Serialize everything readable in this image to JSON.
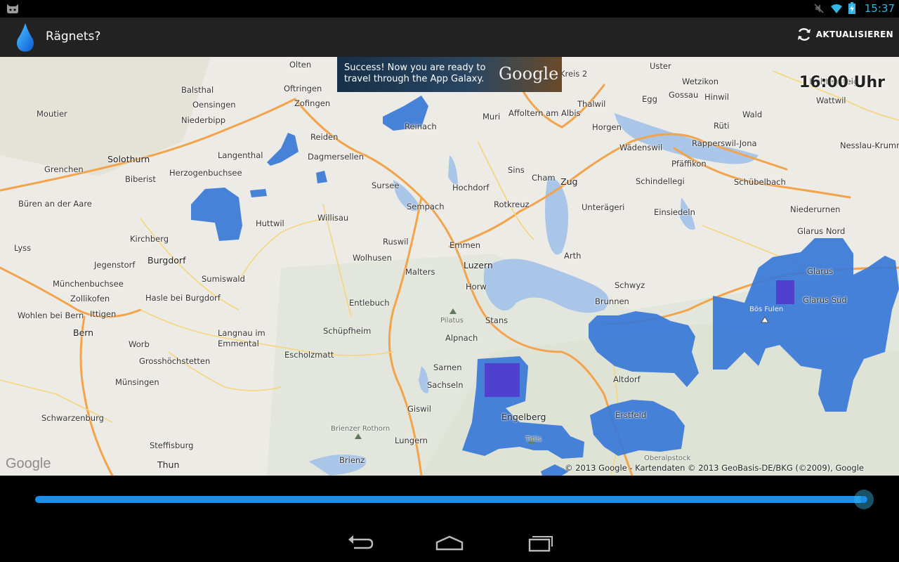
{
  "status_bar": {
    "time": "15:37",
    "icons": [
      "android-cat-icon",
      "mute-icon",
      "wifi-icon",
      "battery-charging-icon"
    ],
    "accent_color": "#33b5e5"
  },
  "app_bar": {
    "title": "Rägnets?",
    "logo_icon": "raindrop-icon",
    "refresh_label": "AKTUALISIEREN",
    "refresh_icon": "refresh-icon"
  },
  "ad": {
    "text": "Success! Now you are ready to travel through the App Galaxy.",
    "brand": "Google"
  },
  "map": {
    "time_overlay": "16:00 Uhr",
    "google_logo": "Google",
    "copyright": "© 2013 Google - Kartendaten © 2013 GeoBasis-DE/BKG (©2009), Google",
    "rain_color": "#3878d8",
    "heavy_rain_color": "#5040d0",
    "places": [
      "Olten",
      "Oftringen",
      "Balsthal",
      "Oensingen",
      "Zofingen",
      "Moutier",
      "Niederbipp",
      "Reiden",
      "Langenthal",
      "Dagmersellen",
      "Solothurn",
      "Grenchen",
      "Herzogenbuchsee",
      "Biberist",
      "Büren an der Aare",
      "Huttwil",
      "Willisau",
      "Kirchberg",
      "Lyss",
      "Burgdorf",
      "Jegenstorf",
      "Münchenbuchsee",
      "Sumiswald",
      "Zollikofen",
      "Hasle bei Burgdorf",
      "Ittigen",
      "Bern",
      "Wohlen bei Bern",
      "Worb",
      "Langnau im Emmental",
      "Grosshöchstetten",
      "Münsingen",
      "Schwarzenburg",
      "Steffisburg",
      "Thun",
      "Sursee",
      "Sempach",
      "Ruswil",
      "Wolhusen",
      "Malters",
      "Emmen",
      "Luzern",
      "Horw",
      "Entlebuch",
      "Schüpfheim",
      "Escholzmatt",
      "Reinach",
      "Muri",
      "Hochdorf",
      "Sins",
      "Affoltern am Albis",
      "Cham",
      "Zug",
      "Rotkreuz",
      "Unterägeri",
      "Arth",
      "Schwyz",
      "Brunnen",
      "Stans",
      "Alpnach",
      "Pilatus",
      "Sarnen",
      "Sachseln",
      "Giswil",
      "Brienzer Rothorn",
      "Lungern",
      "Brienz",
      "Engelberg",
      "Titlis",
      "Erstfeld",
      "Altdorf",
      "Oberalpstock",
      "Glarus Nord",
      "Glarus",
      "Glarus Süd",
      "Bös Fulen",
      "Einsiedeln",
      "Schindellegi",
      "Wädenswil",
      "Horgen",
      "Thalwil",
      "Pfäffikon",
      "Rapperswil-Jona",
      "Schübelbach",
      "Niederurnen",
      "Uster",
      "Wetzikon",
      "Gossau",
      "Hinwil",
      "Egg",
      "Wald",
      "Rüti",
      "Wattwil",
      "Nesslau-Krummen",
      "Kreis 2",
      "Lichtensteig"
    ]
  },
  "slider": {
    "value": 1.0,
    "color": "#1a8ee8"
  },
  "nav_bar": {
    "buttons": [
      "back-icon",
      "home-icon",
      "recent-apps-icon"
    ]
  }
}
